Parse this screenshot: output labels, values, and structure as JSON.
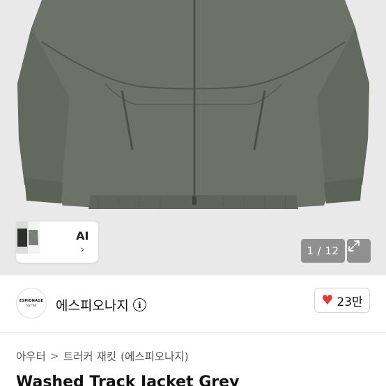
{
  "gallery": {
    "ai_label": "AI",
    "ai_chevron": "›",
    "pager": "1 / 12",
    "expand_icon": "expand-icon"
  },
  "seller": {
    "logo_line1": "ESPIONAGE",
    "logo_line2": "NST'86",
    "name": "에스피오나지",
    "info_icon": "i",
    "like_icon": "♥",
    "like_count": "23만"
  },
  "breadcrumb": {
    "items": [
      "아우터",
      "트러커 재킷",
      "(에스피오나지)"
    ],
    "separator": ">"
  },
  "product": {
    "title": "Washed Track Jacket Grey"
  },
  "colors": {
    "like": "#e53935",
    "jacket": "#6f746b"
  }
}
